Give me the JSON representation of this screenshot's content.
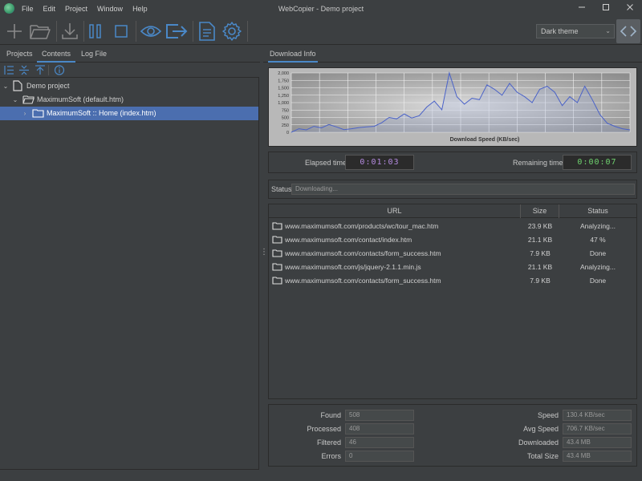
{
  "window": {
    "title": "WebCopier - Demo project"
  },
  "menu": [
    "File",
    "Edit",
    "Project",
    "Window",
    "Help"
  ],
  "toolbar": {
    "icons": [
      "plus-icon",
      "folder-open-icon",
      "download-icon",
      "pause-icon",
      "stop-icon",
      "eye-icon",
      "export-icon",
      "document-icon",
      "gear-icon"
    ],
    "theme_selected": "Dark theme"
  },
  "left_tabs": [
    "Projects",
    "Contents",
    "Log File"
  ],
  "left_active_tab": "Contents",
  "tree": [
    {
      "label": "Demo project"
    },
    {
      "label": "MaximumSoft (default.htm)"
    },
    {
      "label": "MaximumSoft :: Home (index.htm)"
    }
  ],
  "right_tabs": [
    "Download Info"
  ],
  "chart_data": {
    "type": "area",
    "xlabel": "Download Speed (KB/sec)",
    "y_ticks": [
      "2,000",
      "1,750",
      "1,500",
      "1,250",
      "1,000",
      "750",
      "500",
      "250",
      "0"
    ],
    "ylim": [
      0,
      2000
    ],
    "grid": true,
    "values": [
      0,
      120,
      80,
      200,
      150,
      260,
      180,
      90,
      120,
      160,
      180,
      200,
      320,
      500,
      450,
      620,
      480,
      560,
      850,
      1050,
      760,
      2000,
      1200,
      950,
      1150,
      1100,
      1600,
      1450,
      1250,
      1650,
      1350,
      1200,
      1000,
      1450,
      1550,
      1350,
      900,
      1200,
      1000,
      1550,
      1100,
      600,
      300,
      200,
      120,
      80
    ]
  },
  "times": {
    "elapsed_label": "Elapsed time",
    "elapsed_value": "0:01:03",
    "remaining_label": "Remaining time",
    "remaining_value": "0:00:07",
    "elapsed_color": "#b48ae0",
    "remaining_color": "#6fd26f"
  },
  "status": {
    "label": "Status",
    "value": "Downloading..."
  },
  "table": {
    "headers": [
      "URL",
      "Size",
      "Status"
    ],
    "rows": [
      {
        "url": "www.maximumsoft.com/products/wc/tour_mac.htm",
        "size": "23.9 KB",
        "status": "Analyzing..."
      },
      {
        "url": "www.maximumsoft.com/contact/index.htm",
        "size": "21.1 KB",
        "status": "47 %"
      },
      {
        "url": "www.maximumsoft.com/contacts/form_success.htm",
        "size": "7.9 KB",
        "status": "Done"
      },
      {
        "url": "www.maximumsoft.com/js/jquery-2.1.1.min.js",
        "size": "21.1 KB",
        "status": "Analyzing..."
      },
      {
        "url": "www.maximumsoft.com/contacts/form_success.htm",
        "size": "7.9 KB",
        "status": "Done"
      }
    ]
  },
  "stats": {
    "found_label": "Found",
    "found": "508",
    "processed_label": "Processed",
    "processed": "408",
    "filtered_label": "Filtered",
    "filtered": "46",
    "errors_label": "Errors",
    "errors": "0",
    "speed_label": "Speed",
    "speed": "130.4 KB/sec",
    "avg_speed_label": "Avg Speed",
    "avg_speed": "706.7 KB/sec",
    "downloaded_label": "Downloaded",
    "downloaded": "43.4 MB",
    "total_size_label": "Total Size",
    "total_size": "43.4 MB"
  }
}
